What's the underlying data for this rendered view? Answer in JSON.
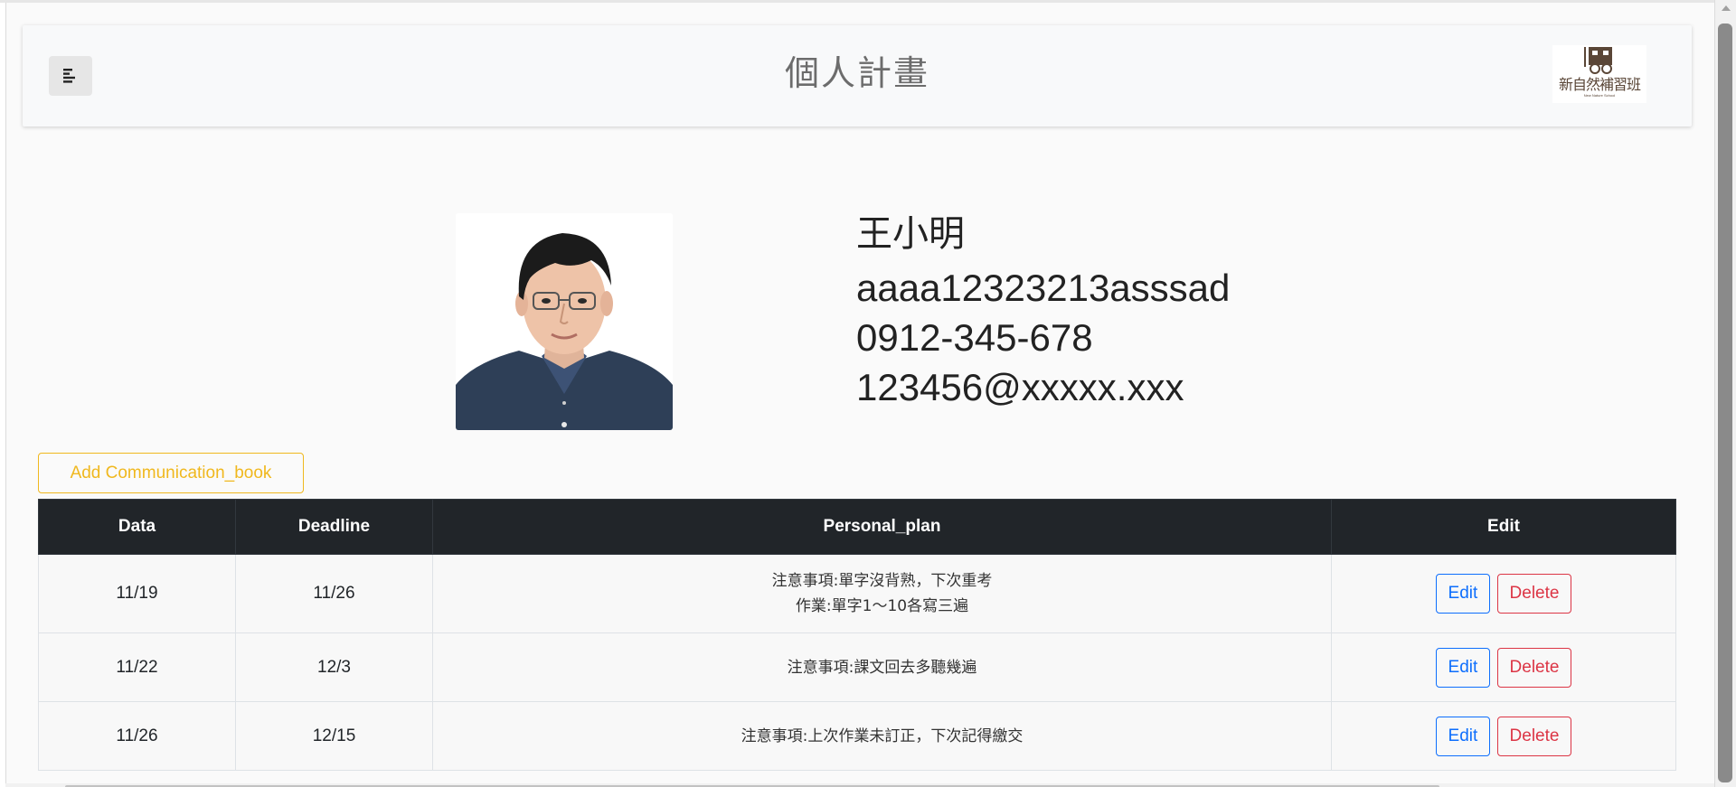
{
  "header": {
    "title": "個人計畫",
    "menu_icon": "align-left-icon",
    "logo": {
      "text": "新自然補習班",
      "subtext": "New Nature School",
      "icon": "cart-logo-icon"
    }
  },
  "profile": {
    "name": "王小明",
    "username": "aaaa12323213asssad",
    "phone": "0912-345-678",
    "email": "123456@xxxxx.xxx"
  },
  "actions": {
    "add_label": "Add Communication_book"
  },
  "table": {
    "headers": [
      "Data",
      "Deadline",
      "Personal_plan",
      "Edit"
    ],
    "rows": [
      {
        "data": "11/19",
        "deadline": "11/26",
        "plan": "注意事項:單字沒背熟，下次重考\n作業:單字1～10各寫三遍",
        "edit_label": "Edit",
        "delete_label": "Delete"
      },
      {
        "data": "11/22",
        "deadline": "12/3",
        "plan": "注意事項:課文回去多聽幾遍",
        "edit_label": "Edit",
        "delete_label": "Delete"
      },
      {
        "data": "11/26",
        "deadline": "12/15",
        "plan": "注意事項:上次作業未訂正，下次記得繳交",
        "edit_label": "Edit",
        "delete_label": "Delete"
      }
    ]
  },
  "colors": {
    "add_button": "#f0b81e",
    "edit_button": "#0d6efd",
    "delete_button": "#dc3545",
    "table_header": "#212529"
  }
}
